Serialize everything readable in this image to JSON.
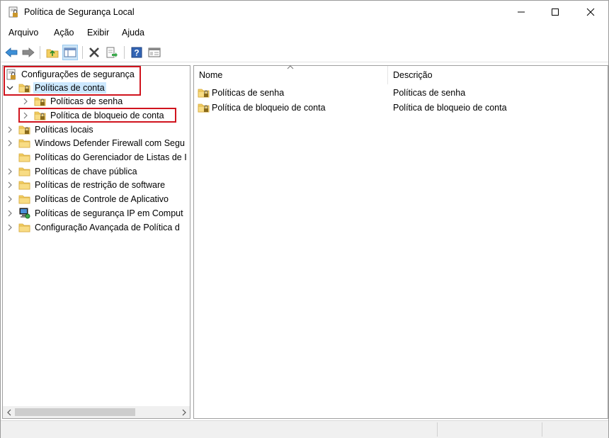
{
  "window": {
    "title": "Política de Segurança Local",
    "app_icon": "security-policy-icon"
  },
  "menu": {
    "items": [
      "Arquivo",
      "Ação",
      "Exibir",
      "Ajuda"
    ]
  },
  "toolbar": {
    "buttons": [
      "back-arrow-icon",
      "forward-arrow-icon",
      "up-folder-icon",
      "show-hide-tree-icon",
      "delete-icon",
      "export-list-icon",
      "help-icon",
      "properties-icon"
    ]
  },
  "tree": {
    "root": "Configurações de segurança",
    "items": [
      {
        "label": "Políticas de conta",
        "state": "expanded",
        "selected": true
      },
      {
        "label": "Políticas de senha",
        "level": 2
      },
      {
        "label": "Política de bloqueio de conta",
        "level": 2
      },
      {
        "label": "Políticas locais"
      },
      {
        "label": "Windows Defender Firewall com Segu"
      },
      {
        "label": "Políticas do Gerenciador de Listas de I"
      },
      {
        "label": "Políticas de chave pública"
      },
      {
        "label": "Políticas de restrição de software"
      },
      {
        "label": "Políticas de Controle de Aplicativo"
      },
      {
        "label": "Políticas de segurança IP em Comput"
      },
      {
        "label": "Configuração Avançada de Política d"
      }
    ]
  },
  "list": {
    "columns": [
      "Nome",
      "Descrição"
    ],
    "rows": [
      {
        "name": "Políticas de senha",
        "description": "Políticas de senha"
      },
      {
        "name": "Política de bloqueio de conta",
        "description": "Política de bloqueio de conta"
      }
    ]
  },
  "colors": {
    "highlight_box": "#d0141e",
    "selection": "#cce8ff",
    "folder": "#f5d46b"
  }
}
